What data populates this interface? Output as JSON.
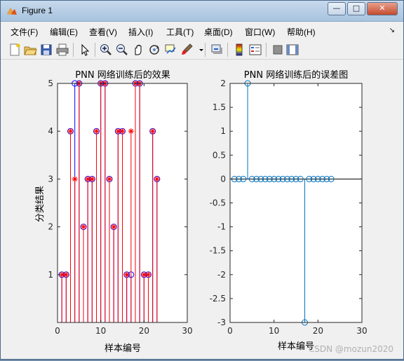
{
  "window": {
    "title": "Figure 1",
    "controls": {
      "minimize": "—",
      "maximize": "□",
      "close": "✕"
    }
  },
  "menu": {
    "items": [
      "文件(F)",
      "编辑(E)",
      "查看(V)",
      "插入(I)",
      "工具(T)",
      "桌面(D)",
      "窗口(W)",
      "帮助(H)"
    ]
  },
  "toolbar": {
    "icons": [
      "new-figure-icon",
      "open-file-icon",
      "save-icon",
      "print-icon",
      "pointer-icon",
      "zoom-in-icon",
      "zoom-out-icon",
      "pan-icon",
      "rotate-icon",
      "data-cursor-icon",
      "brush-icon",
      "link-icon",
      "colorbar-icon",
      "legend-icon",
      "hide-plot-tools-icon",
      "show-plot-tools-icon"
    ]
  },
  "watermark": "CSDN @mozun2020",
  "colors": {
    "red": "#ff0000",
    "blue": "#0000ff",
    "stem_blue": "#0072bd",
    "axis": "#262626"
  },
  "chart_data": [
    {
      "type": "stem",
      "title": "PNN 网络训练后的效果",
      "xlabel": "样本编号",
      "ylabel": "分类结果",
      "xlim": [
        0,
        30
      ],
      "ylim": [
        0,
        5
      ],
      "xticks": [
        "0",
        "10",
        "20",
        "30"
      ],
      "yticks": [
        "1",
        "2",
        "3",
        "4",
        "5"
      ],
      "x": [
        1,
        2,
        3,
        4,
        5,
        6,
        7,
        8,
        9,
        10,
        11,
        12,
        13,
        14,
        15,
        16,
        17,
        18,
        19,
        20,
        21,
        22,
        23
      ],
      "series": [
        {
          "marker": "o",
          "color": "#0000ff",
          "values": [
            1,
            1,
            4,
            5,
            5,
            2,
            3,
            3,
            4,
            5,
            5,
            3,
            2,
            4,
            4,
            1,
            1,
            5,
            5,
            1,
            1,
            4,
            3
          ]
        },
        {
          "marker": "*",
          "color": "#ff0000",
          "stem_color": "#ff0000",
          "values": [
            1,
            1,
            4,
            3,
            5,
            2,
            3,
            3,
            4,
            5,
            5,
            3,
            2,
            4,
            4,
            1,
            4,
            5,
            5,
            1,
            1,
            4,
            3
          ]
        }
      ]
    },
    {
      "type": "stem",
      "title": "PNN 网络训练后的误差图",
      "xlabel": "样本编号",
      "ylabel": "",
      "xlim": [
        0,
        30
      ],
      "ylim": [
        -3,
        2
      ],
      "xticks": [
        "0",
        "10",
        "20",
        "30"
      ],
      "yticks": [
        "-3",
        "-2.5",
        "-2",
        "-1.5",
        "-1",
        "-0.5",
        "0",
        "0.5",
        "1",
        "1.5",
        "2"
      ],
      "x": [
        1,
        2,
        3,
        4,
        5,
        6,
        7,
        8,
        9,
        10,
        11,
        12,
        13,
        14,
        15,
        16,
        17,
        18,
        19,
        20,
        21,
        22,
        23
      ],
      "series": [
        {
          "marker": "o",
          "color": "#0072bd",
          "values": [
            0,
            0,
            0,
            2,
            0,
            0,
            0,
            0,
            0,
            0,
            0,
            0,
            0,
            0,
            0,
            0,
            -3,
            0,
            0,
            0,
            0,
            0,
            0
          ]
        }
      ]
    }
  ]
}
